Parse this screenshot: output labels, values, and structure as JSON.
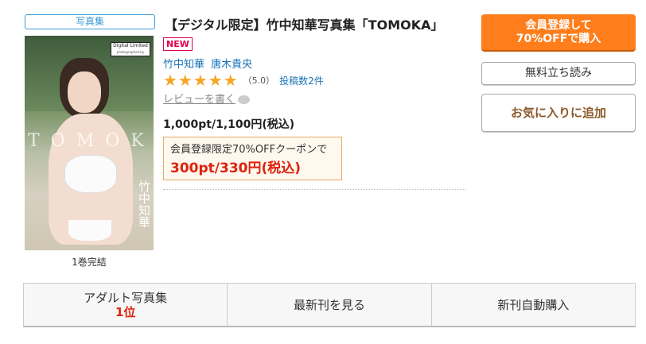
{
  "category_tag": "写真集",
  "cover": {
    "badge_main": "Digital Limited",
    "badge_sub": "photographed by Tomoka",
    "overlay_title": "TOMOKA",
    "vertical_name": "竹中知華"
  },
  "volume_caption": "1巻完結",
  "title": "【デジタル限定】竹中知華写真集「TOMOKA」",
  "new_badge": "NEW",
  "authors": [
    "竹中知華",
    "唐木貴央"
  ],
  "rating": {
    "stars": 5,
    "star_glyphs": "★★★★★",
    "score_text": "（5.0）",
    "reviews_link": "投稿数2件"
  },
  "write_review": "レビューを書く",
  "price": "1,000pt/1,100円(税込)",
  "coupon": {
    "label": "会員登録限定70%OFFクーポンで",
    "price": "300pt/330円(税込)"
  },
  "buttons": {
    "member_line1": "会員登録して",
    "member_line2": "70%OFFで購入",
    "free_read": "無料立ち読み",
    "favorite": "お気に入りに追加"
  },
  "bottom_bar": {
    "ranking_label": "アダルト写真集",
    "ranking_value": "1位",
    "latest": "最新刊を見る",
    "auto_purchase": "新刊自動購入"
  },
  "colors": {
    "accent_orange": "#ff7d1a",
    "link_blue": "#1a73b8",
    "price_red": "#e0220e",
    "star_gold": "#f5a623"
  }
}
